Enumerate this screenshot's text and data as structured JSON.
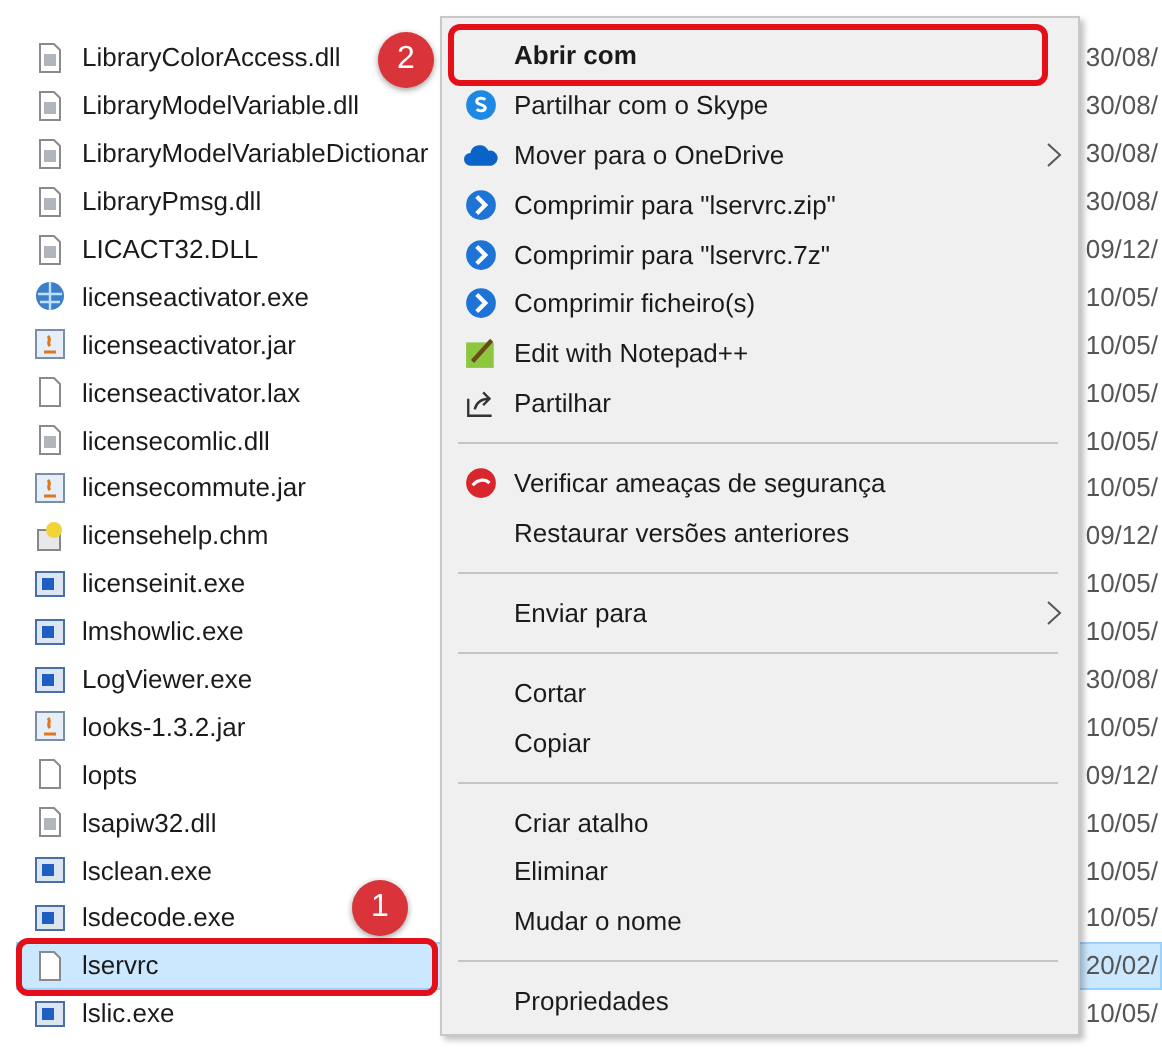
{
  "files": [
    {
      "name": "LibraryColorAccess.dll",
      "kind": "dll",
      "date": "30/08/",
      "selected": false
    },
    {
      "name": "LibraryModelVariable.dll",
      "kind": "dll",
      "date": "30/08/",
      "selected": false
    },
    {
      "name": "LibraryModelVariableDictionar",
      "kind": "dll",
      "date": "30/08/",
      "selected": false
    },
    {
      "name": "LibraryPmsg.dll",
      "kind": "dll",
      "date": "30/08/",
      "selected": false
    },
    {
      "name": "LICACT32.DLL",
      "kind": "dll",
      "date": "09/12/",
      "selected": false
    },
    {
      "name": "licenseactivator.exe",
      "kind": "globe",
      "date": "10/05/",
      "selected": false
    },
    {
      "name": "licenseactivator.jar",
      "kind": "jar",
      "date": "10/05/",
      "selected": false
    },
    {
      "name": "licenseactivator.lax",
      "kind": "blank",
      "date": "10/05/",
      "selected": false
    },
    {
      "name": "licensecomlic.dll",
      "kind": "dll",
      "date": "10/05/",
      "selected": false
    },
    {
      "name": "licensecommute.jar",
      "kind": "jar",
      "date": "10/05/",
      "selected": false
    },
    {
      "name": "licensehelp.chm",
      "kind": "help",
      "date": "09/12/",
      "selected": false
    },
    {
      "name": "licenseinit.exe",
      "kind": "app",
      "date": "10/05/",
      "selected": false
    },
    {
      "name": "lmshowlic.exe",
      "kind": "app",
      "date": "10/05/",
      "selected": false
    },
    {
      "name": "LogViewer.exe",
      "kind": "app",
      "date": "30/08/",
      "selected": false
    },
    {
      "name": "looks-1.3.2.jar",
      "kind": "jar",
      "date": "10/05/",
      "selected": false
    },
    {
      "name": "lopts",
      "kind": "blank",
      "date": "09/12/",
      "selected": false
    },
    {
      "name": "lsapiw32.dll",
      "kind": "dll",
      "date": "10/05/",
      "selected": false
    },
    {
      "name": "lsclean.exe",
      "kind": "app",
      "date": "10/05/",
      "selected": false
    },
    {
      "name": "lsdecode.exe",
      "kind": "app",
      "date": "10/05/",
      "selected": false
    },
    {
      "name": "lservrc",
      "kind": "blank",
      "date": "20/02/",
      "selected": true
    },
    {
      "name": "lslic.exe",
      "kind": "app",
      "date": "10/05/",
      "selected": false
    }
  ],
  "context_menu": [
    {
      "kind": "plain",
      "label": "Abrir com",
      "submenu": false,
      "bold": true
    },
    {
      "kind": "skype",
      "label": "Partilhar com o Skype",
      "submenu": false,
      "bold": false
    },
    {
      "kind": "cloud",
      "label": "Mover para o OneDrive",
      "submenu": true,
      "bold": false
    },
    {
      "kind": "compress",
      "label": "Comprimir para \"lservrc.zip\"",
      "submenu": false,
      "bold": false
    },
    {
      "kind": "compress",
      "label": "Comprimir para \"lservrc.7z\"",
      "submenu": false,
      "bold": false
    },
    {
      "kind": "compress",
      "label": "Comprimir ficheiro(s)",
      "submenu": false,
      "bold": false
    },
    {
      "kind": "notepad",
      "label": "Edit with Notepad++",
      "submenu": false,
      "bold": false
    },
    {
      "kind": "share",
      "label": "Partilhar",
      "submenu": false,
      "bold": false
    },
    {
      "kind": "separator"
    },
    {
      "kind": "shield",
      "label": "Verificar ameaças de segurança",
      "submenu": false,
      "bold": false
    },
    {
      "kind": "plain",
      "label": "Restaurar versões anteriores",
      "submenu": false,
      "bold": false
    },
    {
      "kind": "separator"
    },
    {
      "kind": "plain",
      "label": "Enviar para",
      "submenu": true,
      "bold": false
    },
    {
      "kind": "separator"
    },
    {
      "kind": "plain",
      "label": "Cortar",
      "submenu": false,
      "bold": false
    },
    {
      "kind": "plain",
      "label": "Copiar",
      "submenu": false,
      "bold": false
    },
    {
      "kind": "separator"
    },
    {
      "kind": "plain",
      "label": "Criar atalho",
      "submenu": false,
      "bold": false
    },
    {
      "kind": "plain",
      "label": "Eliminar",
      "submenu": false,
      "bold": false
    },
    {
      "kind": "plain",
      "label": "Mudar o nome",
      "submenu": false,
      "bold": false
    },
    {
      "kind": "separator"
    },
    {
      "kind": "plain",
      "label": "Propriedades",
      "submenu": false,
      "bold": false
    }
  ],
  "callouts": [
    {
      "number": "1"
    },
    {
      "number": "2"
    }
  ]
}
